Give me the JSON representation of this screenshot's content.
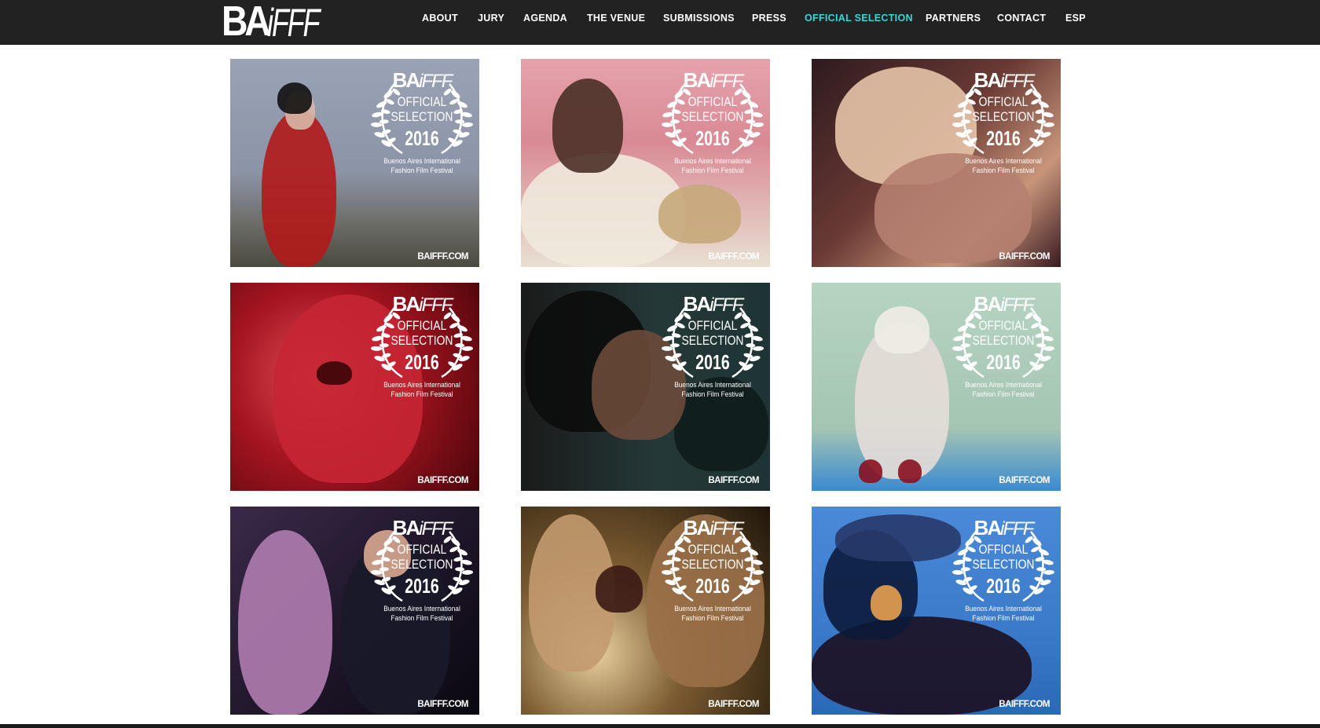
{
  "header": {
    "logo_main": "BA",
    "logo_sub": "iFFF"
  },
  "nav": {
    "items": [
      {
        "label": "ABOUT"
      },
      {
        "label": "JURY"
      },
      {
        "label": "AGENDA"
      },
      {
        "label": "THE VENUE"
      },
      {
        "label": "SUBMISSIONS"
      },
      {
        "label": "PRESS"
      },
      {
        "label": "OFFICIAL SELECTION",
        "active": true
      },
      {
        "label": "PARTNERS"
      },
      {
        "label": "CONTACT"
      },
      {
        "label": "ESP"
      }
    ],
    "active_color": "#35d6dc"
  },
  "badge": {
    "logo_main": "BA",
    "logo_sub": "iFFF",
    "line1": "OFFICIAL",
    "line2": "SELECTION",
    "year": "2016",
    "festival_line1": "Buenos Aires International",
    "festival_line2": "Fashion Film Festival",
    "site": "BAIFFF.COM"
  },
  "tiles": [
    {
      "theme": "woman-red-dress-rooftop",
      "colors": [
        "#8b95a8",
        "#b01c1c"
      ]
    },
    {
      "theme": "girl-with-radio-pink-room",
      "colors": [
        "#d98a94",
        "#e8e0d2"
      ]
    },
    {
      "theme": "blonde-woman-lying",
      "colors": [
        "#5a3a3a",
        "#e2b99a"
      ]
    },
    {
      "theme": "red-face-behind-glass",
      "colors": [
        "#6b0c12",
        "#d6454a"
      ]
    },
    {
      "theme": "man-dreadlocks-speakers",
      "colors": [
        "#1f3838",
        "#6a4a3a"
      ]
    },
    {
      "theme": "white-hair-woman-sitting",
      "colors": [
        "#a5c5b3",
        "#e8ddd8"
      ]
    },
    {
      "theme": "two-women-dark",
      "colors": [
        "#2a1a3a",
        "#b07cb0"
      ]
    },
    {
      "theme": "two-women-apple",
      "colors": [
        "#3a2a18",
        "#c8a070"
      ]
    },
    {
      "theme": "masked-figure-blue-sky",
      "colors": [
        "#3a7ac8",
        "#1a1020"
      ]
    }
  ]
}
